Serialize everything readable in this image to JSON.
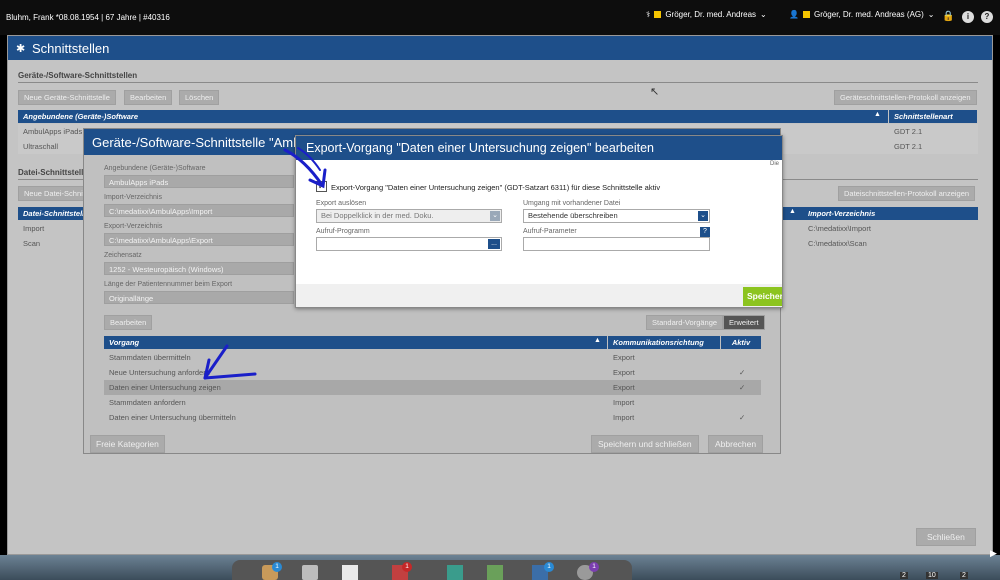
{
  "topbar": {
    "patient": "Bluhm, Frank *08.08.1954 | 67 Jahre | #40316",
    "user1": "Gröger, Dr. med. Andreas",
    "user2": "Gröger, Dr. med. Andreas (AG)",
    "lock": "🔒",
    "info": "i",
    "help": "?"
  },
  "main": {
    "title": "Schnittstellen",
    "section1": "Geräte-/Software-Schnittstellen",
    "buttons1": [
      "Neue Geräte-Schnittstelle",
      "Bearbeiten",
      "Löschen"
    ],
    "protocol_btn": "Geräteschnittstellen-Protokoll anzeigen",
    "table1_headers": [
      "Angebundene (Geräte-)Software",
      "Schnittstellenart"
    ],
    "table1_rows": [
      {
        "name": "AmbulApps iPads",
        "type": "GDT 2.1"
      },
      {
        "name": "Ultraschall",
        "type": "GDT 2.1"
      }
    ],
    "section2": "Datei-Schnittstellen",
    "button2": "Neue Datei-Schnittstelle",
    "protocol_btn2": "Dateischnittstellen-Protokoll anzeigen",
    "table2_headers": [
      "Datei-Schnittstellen",
      "Import-Verzeichnis"
    ],
    "table2_rows": [
      {
        "name": "Import",
        "dir": "C:\\medatixx\\Import"
      },
      {
        "name": "Scan",
        "dir": "C:\\medatixx\\Scan"
      }
    ],
    "close_btn": "Schließen"
  },
  "modal2": {
    "title": "Geräte-/Software-Schnittstelle \"AmbulApps iPads\"",
    "fields": [
      {
        "label": "Angebundene (Geräte-)Software",
        "value": "AmbulApps iPads"
      },
      {
        "label": "Import-Verzeichnis",
        "value": "C:\\medatixx\\AmbulApps\\Import"
      },
      {
        "label": "Export-Verzeichnis",
        "value": "C:\\medatixx\\AmbulApps\\Export"
      },
      {
        "label": "Zeichensatz",
        "value": "1252 - Westeuropäisch (Windows)"
      },
      {
        "label": "Länge der Patientennummer beim Export",
        "value": "Originallänge"
      }
    ],
    "edit_btn": "Bearbeiten",
    "std_btn": "Standard-Vorgänge",
    "ext_btn": "Erweitert",
    "table_headers": [
      "Vorgang",
      "Kommunikationsrichtung",
      "Aktiv"
    ],
    "rows": [
      {
        "name": "Stammdaten übermitteln",
        "dir": "Export",
        "active": ""
      },
      {
        "name": "Neue Untersuchung anfordern",
        "dir": "Export",
        "active": "✓"
      },
      {
        "name": "Daten einer Untersuchung zeigen",
        "dir": "Export",
        "active": "✓"
      },
      {
        "name": "Stammdaten anfordern",
        "dir": "Import",
        "active": ""
      },
      {
        "name": "Daten einer Untersuchung übermitteln",
        "dir": "Import",
        "active": "✓"
      }
    ],
    "free_btn": "Freie Kategorien",
    "save_close": "Speichern und schließen",
    "cancel": "Abbrechen"
  },
  "modal3": {
    "title": "Export-Vorgang \"Daten einer Untersuchung zeigen\" bearbeiten",
    "side_hint": "Die",
    "check_label": "Export-Vorgang \"Daten einer Untersuchung zeigen\" (GDT-Satzart 6311) für diese Schnittstelle aktiv",
    "trigger_label": "Export auslösen",
    "trigger_value": "Bei Doppelklick in der med. Doku.",
    "existing_label": "Umgang mit vorhandener Datei",
    "existing_value": "Bestehende überschreiben",
    "prog_label": "Aufruf-Programm",
    "param_label": "Aufruf-Parameter",
    "browse": "...",
    "help": "?",
    "save": "Speichern"
  },
  "taskbar": {
    "badges": [
      "1",
      "1",
      "1",
      "1"
    ],
    "page_nums": [
      "2",
      "10",
      "2"
    ]
  },
  "colors": {
    "accent": "#1e4f8a",
    "badge_blue": "#2a8ad4",
    "badge_red": "#c62828",
    "save_green": "#8cc41f",
    "annotation": "#1a1fc9"
  }
}
